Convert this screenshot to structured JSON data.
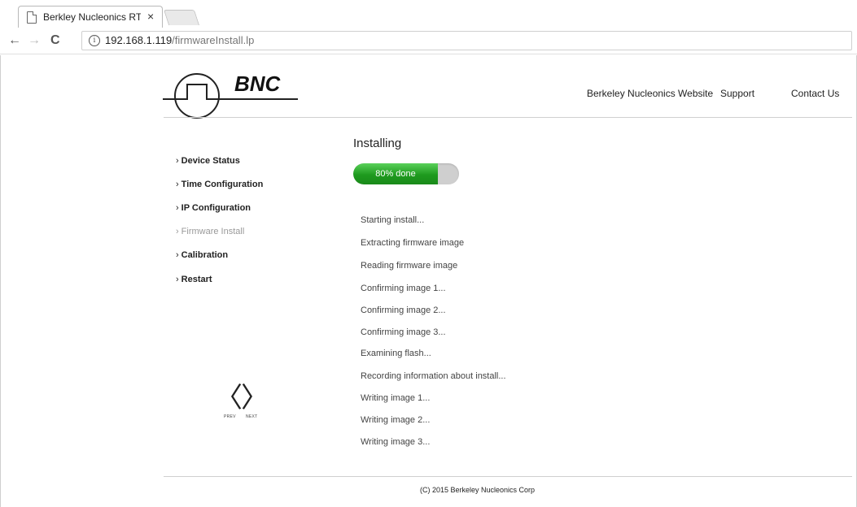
{
  "browser": {
    "tab_title": "Berkley Nucleonics RTSA",
    "close_glyph": "×",
    "url_host": "192.168.1.119",
    "url_path": "/firmwareInstall.lp",
    "back_glyph": "←",
    "forward_glyph": "→",
    "reload_glyph": "C",
    "info_glyph": "i"
  },
  "header": {
    "logo_text": "BNC",
    "nav": [
      {
        "label": "Berkeley Nucleonics Website"
      },
      {
        "label": "Support"
      },
      {
        "label": "Contact Us"
      }
    ]
  },
  "sidebar": {
    "chevron": "›",
    "items": [
      {
        "label": "Device Status",
        "active": false
      },
      {
        "label": "Time Configuration",
        "active": false
      },
      {
        "label": "IP Configuration",
        "active": false
      },
      {
        "label": "Firmware Install",
        "active": true
      },
      {
        "label": "Calibration",
        "active": false
      },
      {
        "label": "Restart",
        "active": false
      }
    ],
    "pager": {
      "prev_glyph": "〈",
      "next_glyph": "〉",
      "prev_label": "PREV",
      "next_label": "NEXT"
    }
  },
  "main": {
    "title": "Installing",
    "progress_label": "80% done",
    "progress_fraction": 0.8,
    "log": [
      "Starting install...",
      "Extracting firmware image",
      "Reading firmware image",
      "Confirming image 1...",
      "Confirming image 2...",
      "Confirming image 3...",
      "Examining flash...",
      "Recording information about install...",
      "Writing image 1...",
      "Writing image 2...",
      "Writing image 3..."
    ]
  },
  "footer": {
    "text": "(C) 2015 Berkeley Nucleonics Corp"
  },
  "colors": {
    "progress_green": "#2aa52a",
    "progress_track": "#cfcfcf",
    "active_sidebar": "#999999"
  }
}
